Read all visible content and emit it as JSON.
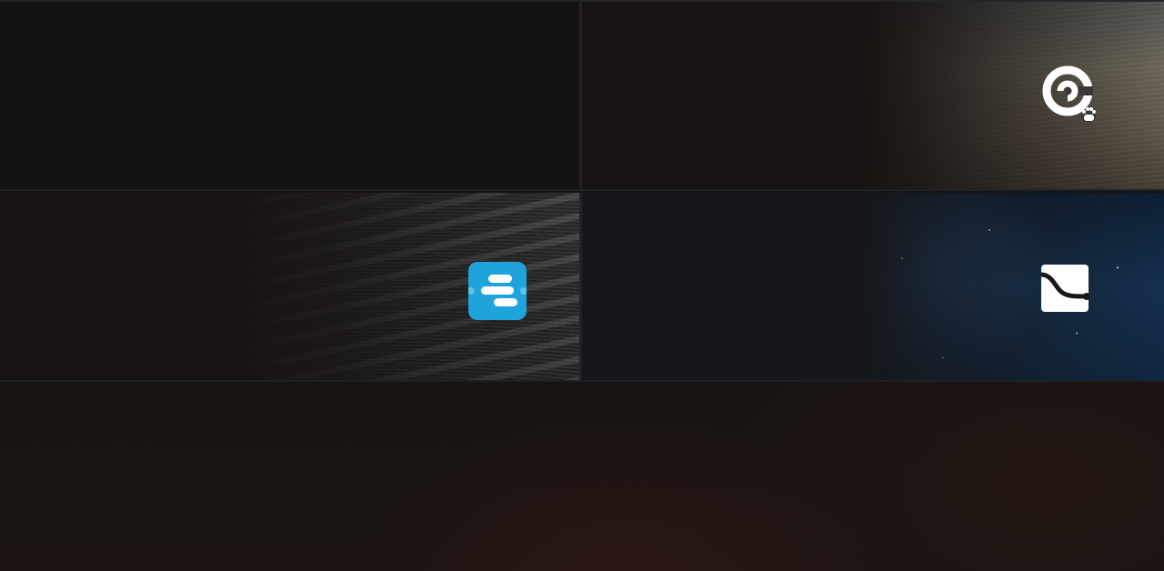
{
  "tiles": [
    {
      "name": "empty-tile",
      "icon": "none"
    },
    {
      "name": "cibn-baidu-app-tile",
      "icon": "cibn-baidu-icon",
      "background": "water-surface"
    },
    {
      "name": "blue-app-tile",
      "icon": "blue-lines-app-icon",
      "background": "keyboard-keys",
      "accent": "#1fa3db"
    },
    {
      "name": "flow-app-tile",
      "icon": "curve-line-app-icon",
      "background": "starry-sky"
    }
  ],
  "colors": {
    "background": "#161312",
    "divider": "#1f2326",
    "blue_accent": "#1fa3db"
  }
}
